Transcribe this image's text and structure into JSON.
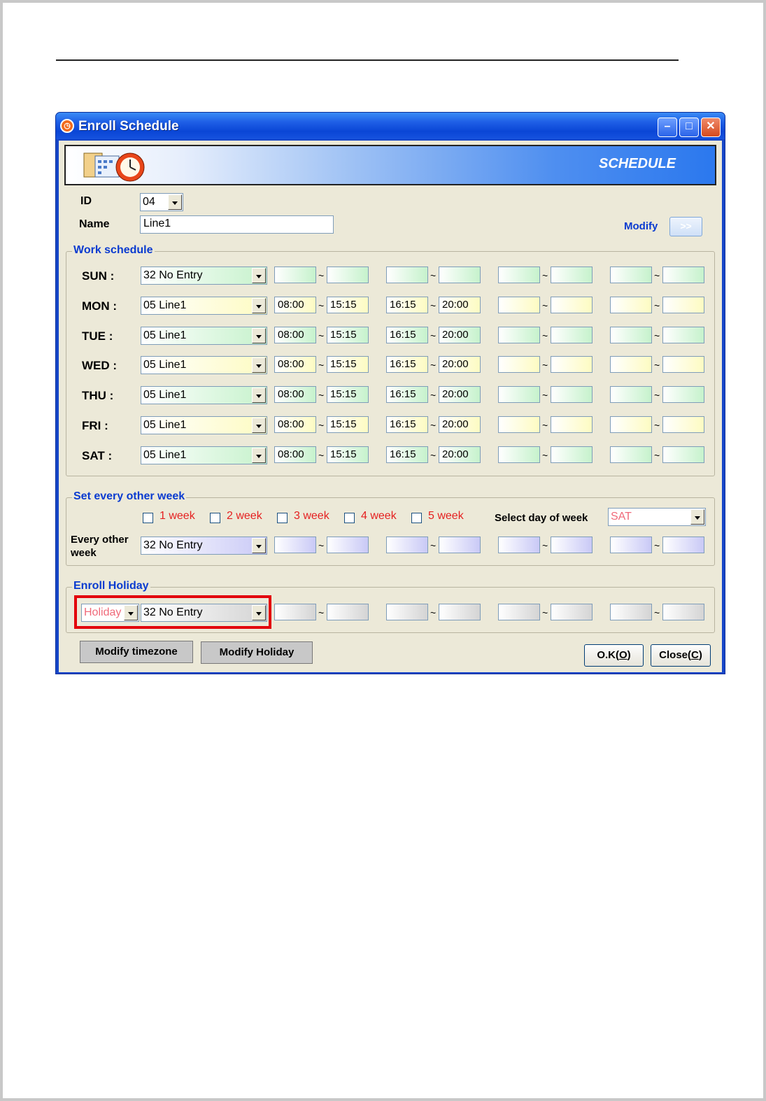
{
  "window": {
    "title": "Enroll Schedule",
    "banner_title": "SCHEDULE"
  },
  "form": {
    "id_label": "ID",
    "id_value": "04",
    "name_label": "Name",
    "name_value": "Line1",
    "modify_label": "Modify",
    "modify_button": ">>"
  },
  "work_schedule": {
    "title": "Work schedule",
    "rows": [
      {
        "day": "SUN :",
        "timezone": "32 No Entry",
        "color": "green",
        "times": [
          "",
          "",
          "",
          "",
          "",
          "",
          "",
          ""
        ]
      },
      {
        "day": "MON :",
        "timezone": "05 Line1",
        "color": "yellow",
        "times": [
          "08:00",
          "15:15",
          "16:15",
          "20:00",
          "",
          "",
          "",
          ""
        ]
      },
      {
        "day": "TUE :",
        "timezone": "05 Line1",
        "color": "green",
        "times": [
          "08:00",
          "15:15",
          "16:15",
          "20:00",
          "",
          "",
          "",
          ""
        ]
      },
      {
        "day": "WED :",
        "timezone": "05 Line1",
        "color": "yellow",
        "times": [
          "08:00",
          "15:15",
          "16:15",
          "20:00",
          "",
          "",
          "",
          ""
        ]
      },
      {
        "day": "THU :",
        "timezone": "05 Line1",
        "color": "green",
        "times": [
          "08:00",
          "15:15",
          "16:15",
          "20:00",
          "",
          "",
          "",
          ""
        ]
      },
      {
        "day": "FRI :",
        "timezone": "05 Line1",
        "color": "yellow",
        "times": [
          "08:00",
          "15:15",
          "16:15",
          "20:00",
          "",
          "",
          "",
          ""
        ]
      },
      {
        "day": "SAT :",
        "timezone": "05 Line1",
        "color": "green",
        "times": [
          "08:00",
          "15:15",
          "16:15",
          "20:00",
          "",
          "",
          "",
          ""
        ]
      }
    ]
  },
  "every_other_week": {
    "title": "Set every other week",
    "weeks": [
      "1 week",
      "2 week",
      "3 week",
      "4 week",
      "5 week"
    ],
    "select_day_label": "Select day of week",
    "select_day_value": "SAT",
    "row_label": "Every other week",
    "timezone": "32 No Entry"
  },
  "holiday": {
    "title": "Enroll Holiday",
    "holiday_combo": "Holiday",
    "timezone": "32 No Entry"
  },
  "buttons": {
    "modify_timezone": "Modify timezone",
    "modify_holiday": "Modify Holiday",
    "ok_pre": "O.K(",
    "ok_key": "O",
    "ok_post": ")",
    "close_pre": "Close(",
    "close_key": "C",
    "close_post": ")"
  },
  "colors": {
    "title_blue": "#0a46d6",
    "highlight_red": "#e3000b",
    "label_blue": "#0a3bd0",
    "red_text": "#e52020"
  }
}
